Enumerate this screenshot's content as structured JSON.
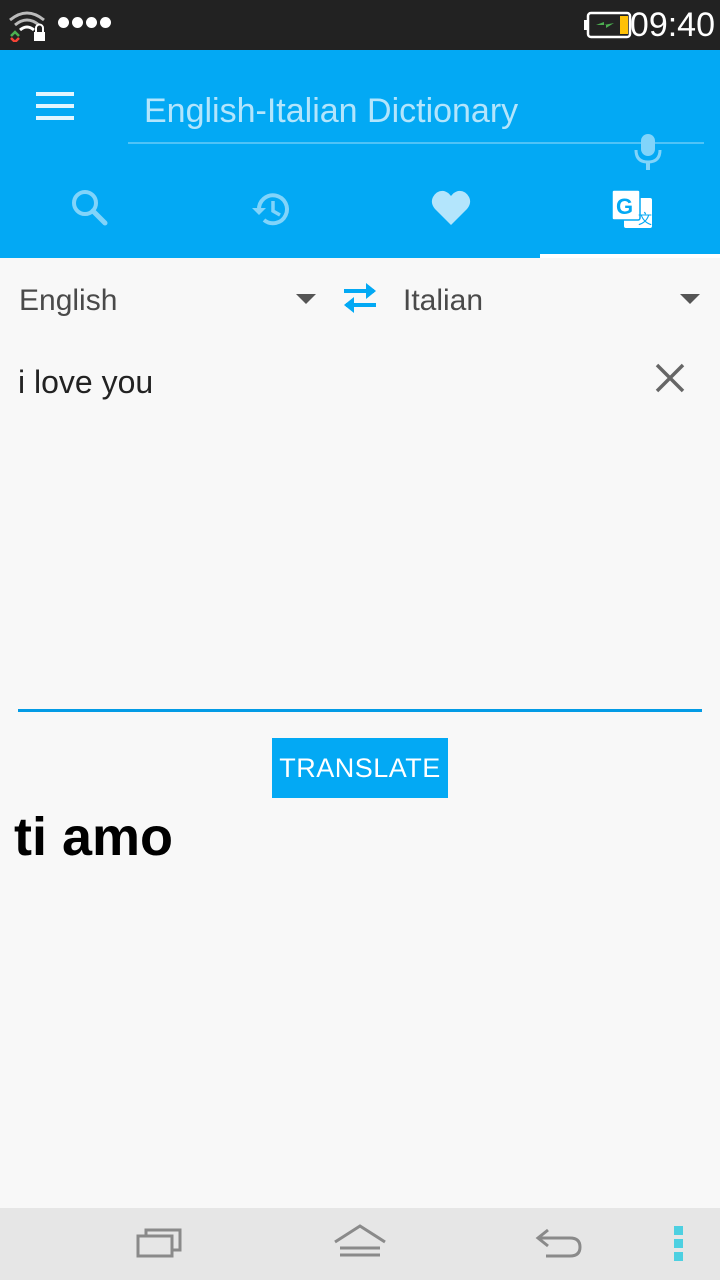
{
  "status_bar": {
    "time": "09:40",
    "icons": [
      "wifi-icon",
      "signal-dots-icon",
      "battery-charging-icon"
    ]
  },
  "app_bar": {
    "search_placeholder": "English-Italian Dictionary",
    "menu_icon": "hamburger-menu-icon",
    "mic_icon": "microphone-icon",
    "tabs": [
      {
        "name": "search",
        "icon": "search-icon"
      },
      {
        "name": "history",
        "icon": "history-icon"
      },
      {
        "name": "favorites",
        "icon": "heart-icon"
      },
      {
        "name": "translate",
        "icon": "google-translate-icon",
        "selected": true
      }
    ]
  },
  "translator": {
    "from_language": "English",
    "to_language": "Italian",
    "input_text": "i love you",
    "translate_label": "TRANSLATE",
    "result_text": "ti amo"
  },
  "nav_bar": {
    "icons": [
      "recents-icon",
      "home-icon",
      "back-icon",
      "more-icon"
    ]
  },
  "colors": {
    "accent": "#03a9f4",
    "status_bar": "#222222",
    "background": "#f8f8f8"
  }
}
